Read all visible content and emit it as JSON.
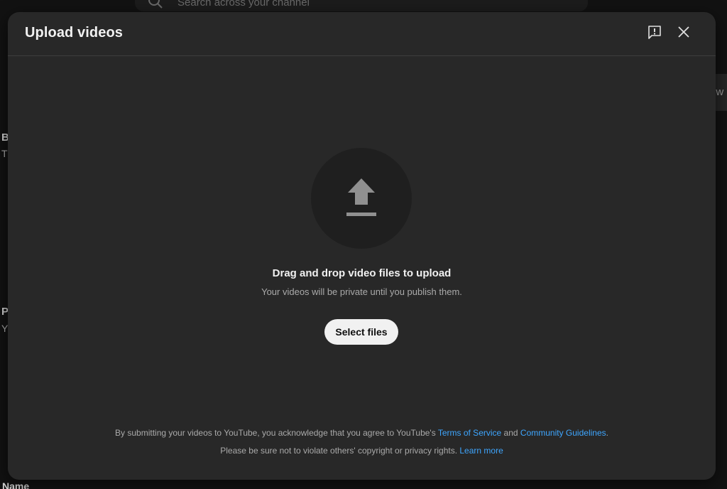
{
  "background": {
    "search_placeholder": "Search across your channel",
    "right_button_label": "ew",
    "section_letters": [
      {
        "label": "B",
        "big": true
      },
      {
        "label": "T",
        "big": false
      },
      {
        "label": "P",
        "big": true
      },
      {
        "label": "Y",
        "big": false
      }
    ],
    "bottom_label": "Name"
  },
  "modal": {
    "title": "Upload videos",
    "drag_title": "Drag and drop video files to upload",
    "drag_subtitle": "Your videos will be private until you publish them.",
    "select_button_label": "Select files",
    "legal": {
      "line1_prefix": "By submitting your videos to YouTube, you acknowledge that you agree to YouTube's ",
      "terms_link": "Terms of Service",
      "line1_and": " and ",
      "guidelines_link": "Community Guidelines",
      "line1_suffix": ".",
      "line2_prefix": "Please be sure not to violate others' copyright or privacy rights. ",
      "learn_more_link": "Learn more"
    }
  },
  "colors": {
    "modal_bg": "#282828",
    "link": "#3ea6ff",
    "button_bg": "#f1f1f1",
    "icon_circle": "#1f1f1f",
    "upload_icon": "#909090"
  },
  "icons": {
    "search": "search-icon",
    "feedback": "feedback-icon",
    "close": "close-icon",
    "upload": "upload-arrow-icon"
  }
}
